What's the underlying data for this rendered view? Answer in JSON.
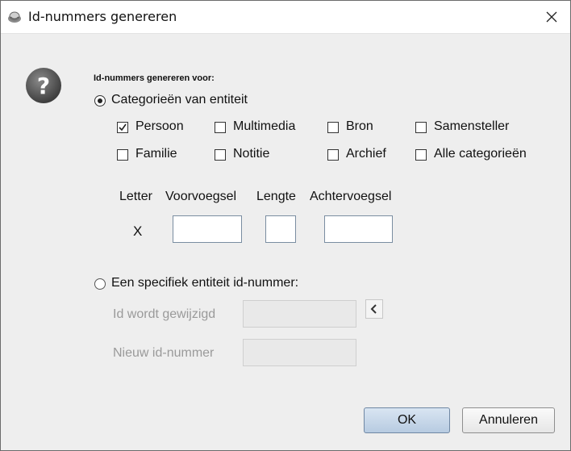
{
  "window": {
    "title": "Id-nummers genereren",
    "close_icon": "close-icon"
  },
  "section": {
    "heading": "Id-nummers genereren voor:"
  },
  "option_categories": {
    "label": "Categorieën van entiteit",
    "selected": true
  },
  "categories": [
    {
      "label": "Persoon",
      "checked": true
    },
    {
      "label": "Multimedia",
      "checked": false
    },
    {
      "label": "Bron",
      "checked": false
    },
    {
      "label": "Samensteller",
      "checked": false
    },
    {
      "label": "Familie",
      "checked": false
    },
    {
      "label": "Notitie",
      "checked": false
    },
    {
      "label": "Archief",
      "checked": false
    },
    {
      "label": "Alle categorieën",
      "checked": false
    }
  ],
  "format": {
    "col_letter": "Letter",
    "col_prefix": "Voorvoegsel",
    "col_length": "Lengte",
    "col_suffix": "Achtervoegsel",
    "letter_value": "X",
    "prefix_value": "",
    "length_value": "",
    "suffix_value": ""
  },
  "option_specific": {
    "label": "Een specifiek entiteit id-nummer:",
    "selected": false,
    "changed_label": "Id wordt gewijzigd",
    "changed_value": "",
    "new_label": "Nieuw id-nummer",
    "new_value": ""
  },
  "buttons": {
    "ok": "OK",
    "cancel": "Annuleren"
  },
  "colors": {
    "ok_button": "#c6d6e8",
    "background": "#eeeeee"
  }
}
